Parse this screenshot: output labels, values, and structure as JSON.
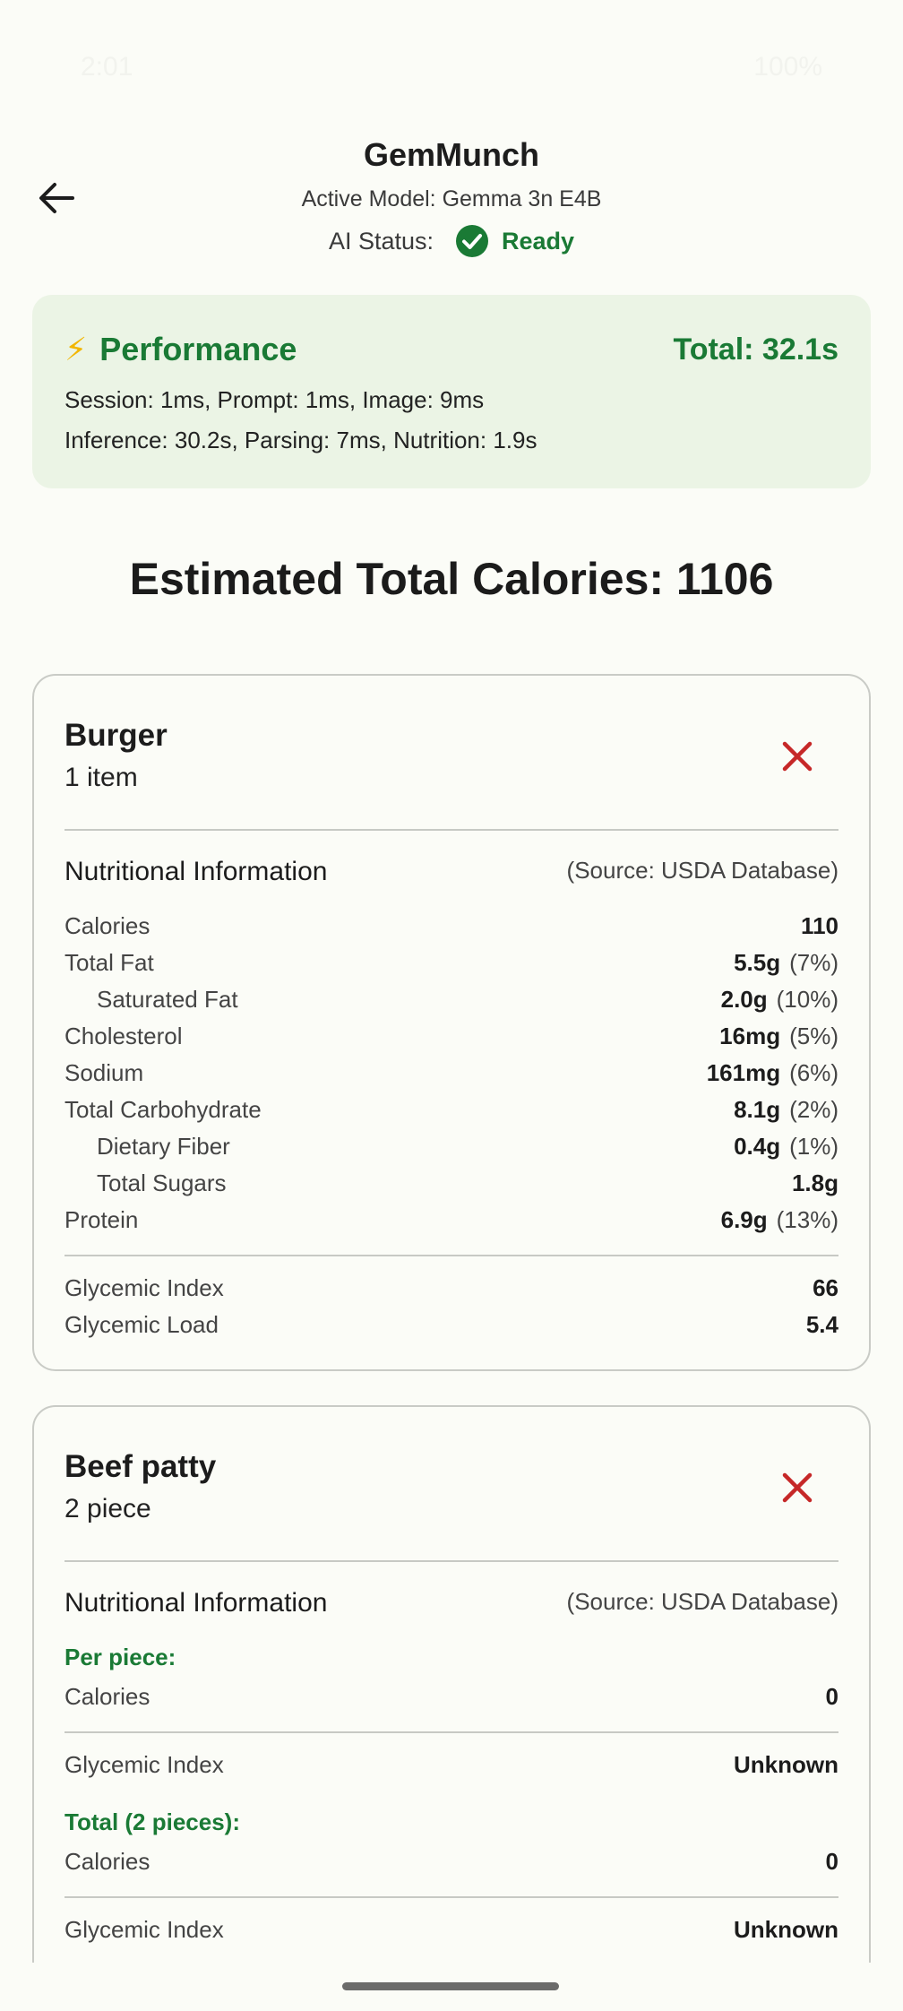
{
  "status_bar": {
    "time": "2:01",
    "battery": "100%"
  },
  "header": {
    "title": "GemMunch",
    "active_model": "Active Model: Gemma 3n E4B",
    "ai_status_label": "AI Status:",
    "ai_status_value": "Ready"
  },
  "performance": {
    "icon": "⚡",
    "title": "Performance",
    "total": "Total: 32.1s",
    "line1": "Session: 1ms, Prompt: 1ms, Image: 9ms",
    "line2": "Inference: 30.2s, Parsing: 7ms, Nutrition: 1.9s"
  },
  "total_calories": "Estimated Total Calories: 1106",
  "foods": [
    {
      "name": "Burger",
      "quantity": "1 item",
      "nutrition_heading": "Nutritional Information",
      "source": "(Source: USDA Database)",
      "rows": [
        {
          "label": "Calories",
          "value": "110",
          "dv": ""
        },
        {
          "label": "Total Fat",
          "value": "5.5g",
          "dv": "(7%)"
        },
        {
          "label": "Saturated Fat",
          "value": "2.0g",
          "dv": "(10%)"
        },
        {
          "label": "Cholesterol",
          "value": "16mg",
          "dv": "(5%)"
        },
        {
          "label": "Sodium",
          "value": "161mg",
          "dv": "(6%)"
        },
        {
          "label": "Total Carbohydrate",
          "value": "8.1g",
          "dv": "(2%)"
        },
        {
          "label": "Dietary Fiber",
          "value": "0.4g",
          "dv": "(1%)"
        },
        {
          "label": "Total Sugars",
          "value": "1.8g",
          "dv": ""
        },
        {
          "label": "Protein",
          "value": "6.9g",
          "dv": "(13%)"
        }
      ],
      "glycemic": [
        {
          "label": "Glycemic Index",
          "value": "66"
        },
        {
          "label": "Glycemic Load",
          "value": "5.4"
        }
      ]
    },
    {
      "name": "Beef patty",
      "quantity": "2 piece",
      "nutrition_heading": "Nutritional Information",
      "source": "(Source: USDA Database)",
      "per_piece_label": "Per piece:",
      "per_piece_calories_label": "Calories",
      "per_piece_calories": "0",
      "per_piece_gi_label": "Glycemic Index",
      "per_piece_gi": "Unknown",
      "total_label": "Total (2 pieces):",
      "total_calories_label": "Calories",
      "total_calories": "0",
      "total_gi_label": "Glycemic Index",
      "total_gi": "Unknown"
    }
  ]
}
